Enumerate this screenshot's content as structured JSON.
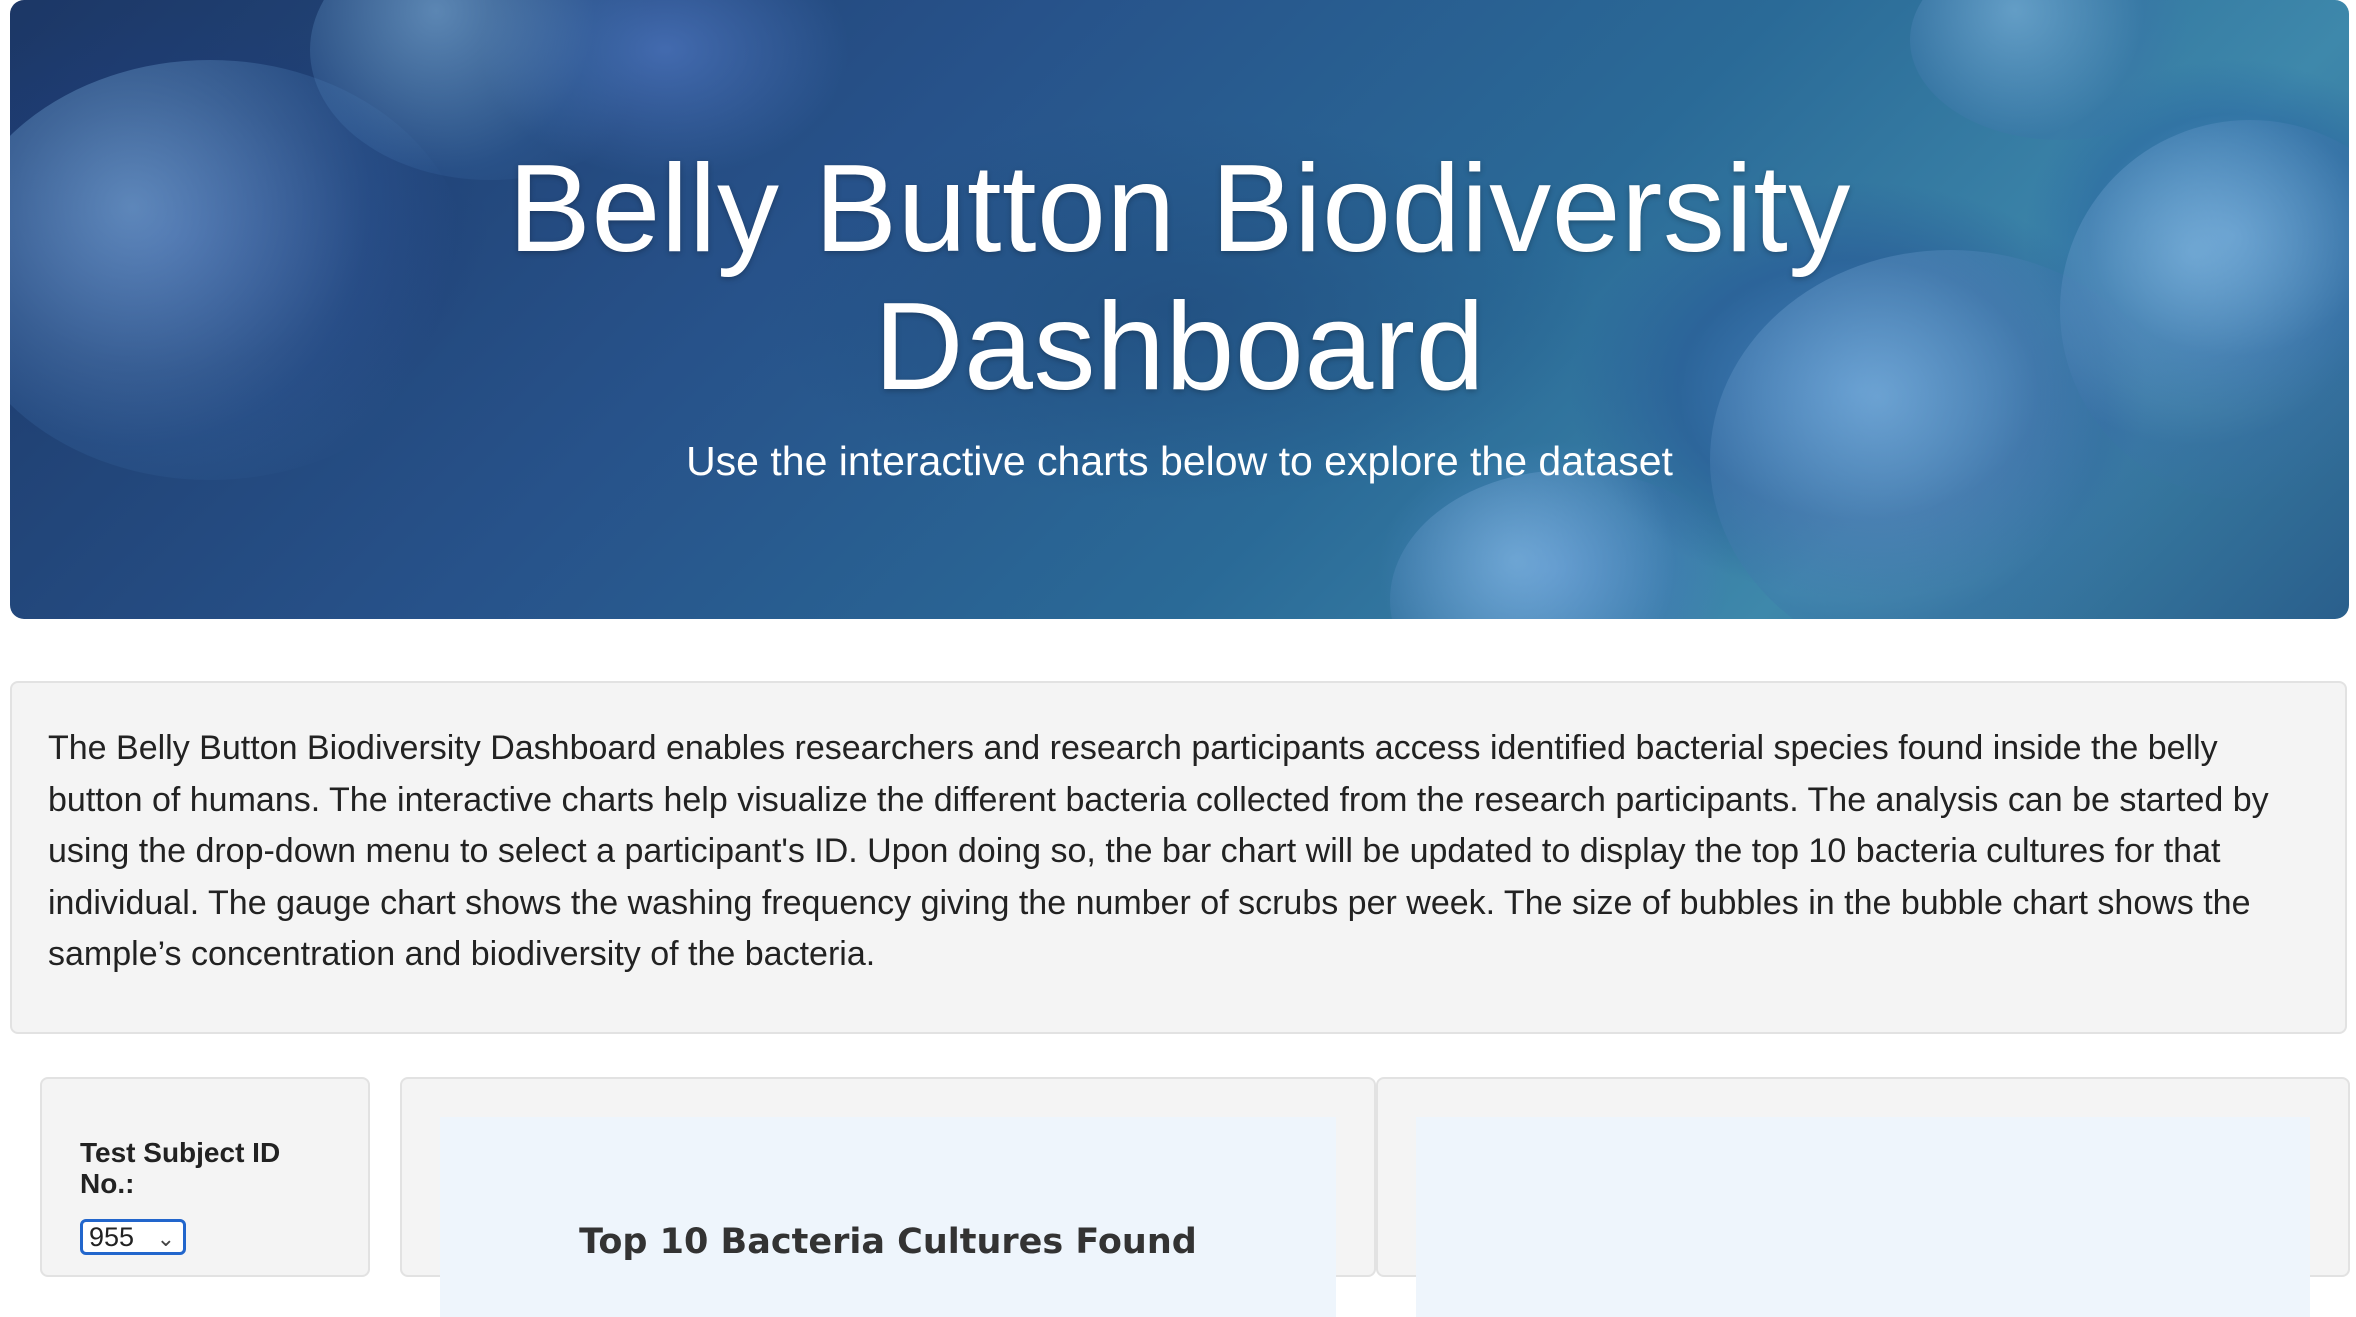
{
  "hero": {
    "title_line1": "Belly Button Biodiversity",
    "title_line2": "Dashboard",
    "subtitle": "Use the interactive charts below to explore the dataset"
  },
  "intro": {
    "text": "The Belly Button Biodiversity Dashboard enables researchers and research participants access identified bacterial species found inside the belly button of humans. The interactive charts help visualize the different bacteria collected from the research participants. The analysis can be started by using the drop-down menu to select a participant's ID. Upon doing so, the bar chart will be updated to display the top 10 bacteria cultures for that individual. The gauge chart shows the washing frequency giving the number of scrubs per week. The size of bubbles in the bubble chart shows the sample’s concentration and biodiversity of the bacteria."
  },
  "selector": {
    "label": "Test Subject ID No.:",
    "selected_value": "955",
    "icon": "chevron-down-icon"
  },
  "bar_chart": {
    "title": "Top 10 Bacteria Cultures Found"
  },
  "gauge_chart": {
    "title": ""
  },
  "colors": {
    "hero_text": "#ffffff",
    "well_background": "#f4f4f4",
    "plot_background": "#eef5fc",
    "select_border": "#2266cc"
  }
}
